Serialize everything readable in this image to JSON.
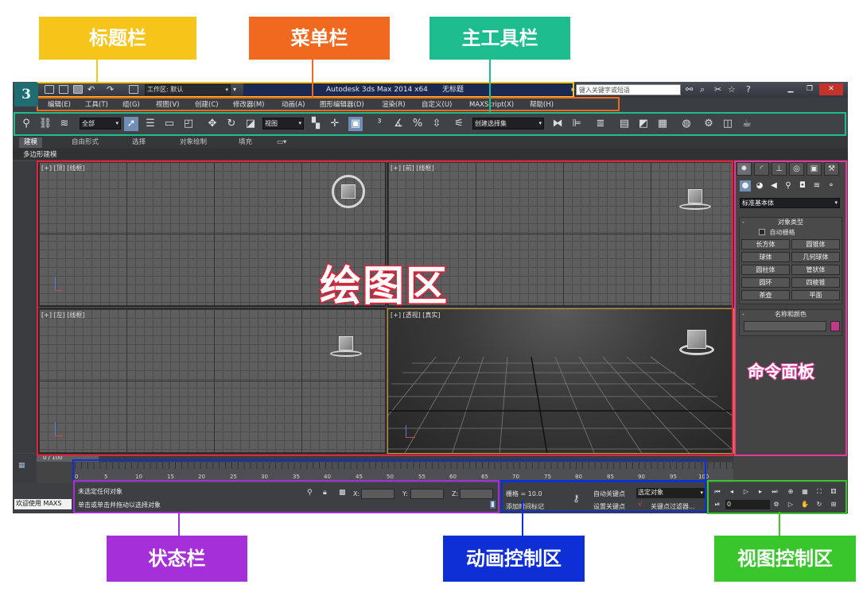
{
  "annotations": {
    "title_bar": "标题栏",
    "menu_bar": "菜单栏",
    "main_toolbar": "主工具栏",
    "drawing_area": "绘图区",
    "command_panel": "命令面板",
    "status_bar": "状态栏",
    "animation_control": "动画控制区",
    "view_control": "视图控制区"
  },
  "colors": {
    "title_bar": "#f7c41a",
    "menu_bar": "#f0691e",
    "main_toolbar": "#1dbd8f",
    "drawing_area": "#e8203a",
    "command_panel": "#e7389a",
    "status_bar": "#a52fd9",
    "animation_control": "#0f2fd6",
    "view_control": "#39c62d"
  },
  "app": {
    "logo": "3",
    "workspace": "工作区: 默认",
    "title_app": "Autodesk 3ds Max  2014 x64",
    "title_file": "无标题",
    "search_placeholder": "键入关键字或短语"
  },
  "menu": [
    "编辑(E)",
    "工具(T)",
    "组(G)",
    "视图(V)",
    "创建(C)",
    "修改器(M)",
    "动画(A)",
    "图形编辑器(D)",
    "渲染(R)",
    "自定义(U)",
    "MAXScript(X)",
    "帮助(H)"
  ],
  "toolbar": {
    "filter": "全部",
    "coord_system": "视图",
    "selection_set": "创建选择集"
  },
  "ribbon": {
    "tabs": [
      "建模",
      "自由形式",
      "选择",
      "对象绘制",
      "填充"
    ],
    "sub_label": "多边形建模"
  },
  "viewports": {
    "top": "[+] [顶] [线框]",
    "front": "[+] [前] [线框]",
    "left": "[+] [左] [线框]",
    "perspective": "[+] [透视] [真实]"
  },
  "command_panel": {
    "category": "标准基本体",
    "object_type_title": "对象类型",
    "autogrid": "自动栅格",
    "buttons": [
      "长方体",
      "圆锥体",
      "球体",
      "几何球体",
      "圆柱体",
      "管状体",
      "圆环",
      "四棱锥",
      "茶壶",
      "平面"
    ],
    "name_color_title": "名称和颜色"
  },
  "timeline": {
    "position": "0 / 100",
    "ticks": [
      "0",
      "5",
      "10",
      "15",
      "20",
      "25",
      "30",
      "35",
      "40",
      "45",
      "50",
      "55",
      "60",
      "65",
      "70",
      "75",
      "80",
      "85",
      "90",
      "95",
      "100"
    ]
  },
  "status": {
    "script_listener": "欢迎使用 MAXS",
    "selection": "未选定任何对象",
    "prompt": "单击或单击并拖动以选择对象",
    "x_label": "X:",
    "y_label": "Y:",
    "z_label": "Z:",
    "grid": "栅格 = 10.0",
    "add_time_tag": "添加时间标记",
    "auto_key": "自动关键点",
    "set_key": "设置关键点",
    "selected_object": "选定对象",
    "key_filters": "关键点过滤器...",
    "frame": "0"
  }
}
